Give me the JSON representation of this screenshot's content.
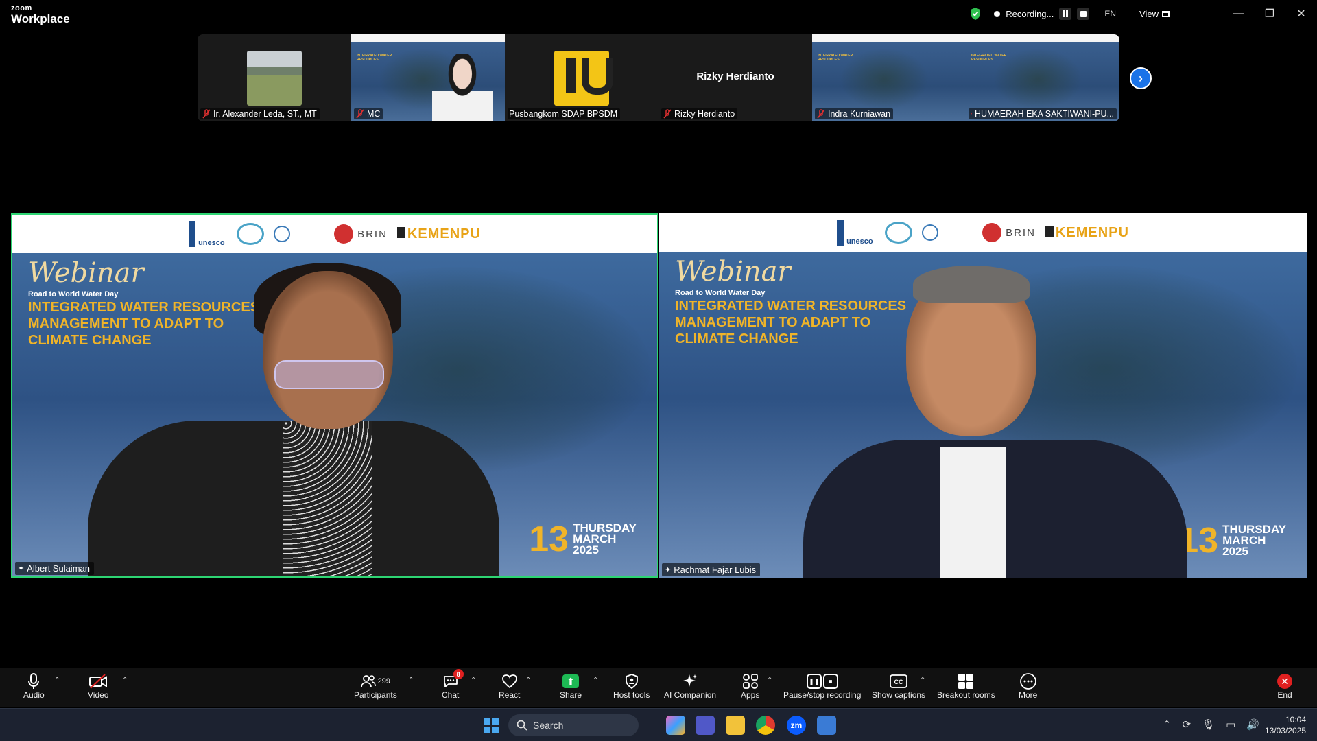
{
  "app": {
    "brand_top": "zoom",
    "brand_bottom": "Workplace"
  },
  "titlebar": {
    "recording_label": "Recording...",
    "language": "EN",
    "view_label": "View",
    "minimize": "—",
    "restore": "❐",
    "close": "✕"
  },
  "thumbnails": [
    {
      "name": "Ir. Alexander Leda, ST., MT",
      "muted": true,
      "kind": "photo"
    },
    {
      "name": "MC",
      "muted": true,
      "kind": "slide-person"
    },
    {
      "name": "Pusbangkom SDAP BPSDM",
      "muted": false,
      "kind": "logo"
    },
    {
      "name": "Rizky Herdianto",
      "muted": true,
      "kind": "text",
      "center_label": "Rizky Herdianto"
    },
    {
      "name": "Indra Kurniawan",
      "muted": true,
      "kind": "slide"
    },
    {
      "name": "HUMAERAH EKA SAKTIWANI-PU...",
      "muted": true,
      "kind": "slide"
    }
  ],
  "next_arrow": "›",
  "slide": {
    "banner": {
      "unesco": "unesco",
      "brin": "BRIN",
      "kemenpu": "KEMENPU"
    },
    "webinar": "Webinar",
    "road_to": "Road  to World Water Day",
    "headline_lines": [
      "INTEGRATED WATER RESOURCES",
      "MANAGEMENT  TO ADAPT TO",
      "CLIMATE CHANGE"
    ],
    "day": "13",
    "date_lines": [
      "THURSDAY",
      "MARCH",
      "2025"
    ]
  },
  "videos": [
    {
      "name": "Albert Sulaiman",
      "active": true
    },
    {
      "name": "Rachmat Fajar Lubis",
      "active": false
    }
  ],
  "toolbar": {
    "audio": "Audio",
    "video": "Video",
    "participants": "Participants",
    "participant_count": "299",
    "chat": "Chat",
    "chat_badge": "8",
    "react": "React",
    "share": "Share",
    "host_tools": "Host tools",
    "ai_companion": "AI Companion",
    "apps": "Apps",
    "pause_stop": "Pause/stop recording",
    "captions": "Show captions",
    "breakout": "Breakout rooms",
    "more": "More",
    "end": "End"
  },
  "taskbar": {
    "search_label": "Search",
    "time": "10:04",
    "date": "13/03/2025"
  },
  "colors": {
    "active_speaker": "#2ed573",
    "share_green": "#1db954",
    "end_red": "#e02020",
    "accent_yellow": "#f0b429"
  }
}
